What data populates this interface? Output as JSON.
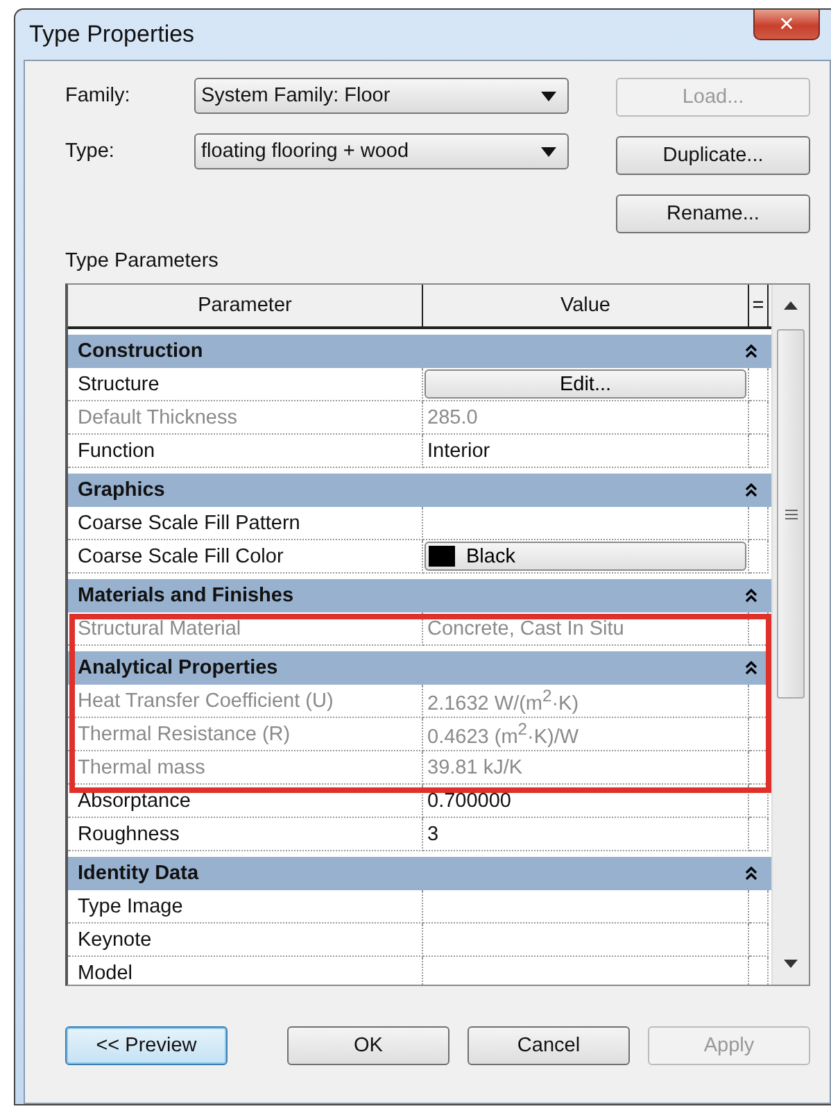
{
  "window": {
    "title": "Type Properties",
    "close": "✕"
  },
  "fields": [
    {
      "label": "Family:",
      "value": "System Family: Floor"
    },
    {
      "label": "Type:",
      "value": "floating flooring + wood"
    }
  ],
  "side_buttons": [
    {
      "label": "Load...",
      "disabled": true
    },
    {
      "label": "Duplicate...",
      "disabled": false
    },
    {
      "label": "Rename...",
      "disabled": false
    }
  ],
  "section_title": "Type Parameters",
  "table": {
    "columns": [
      "Parameter",
      "Value",
      "="
    ],
    "rows": [
      {
        "kind": "group",
        "label": "Construction",
        "expanded": true
      },
      {
        "kind": "button",
        "label": "Structure",
        "value": "Edit...",
        "disabled": false
      },
      {
        "kind": "text",
        "label": "Default Thickness",
        "value": "285.0",
        "disabled": true
      },
      {
        "kind": "text",
        "label": "Function",
        "value": "Interior",
        "disabled": false
      },
      {
        "kind": "group",
        "label": "Graphics",
        "expanded": true
      },
      {
        "kind": "text",
        "label": "Coarse Scale Fill Pattern",
        "disabled": false
      },
      {
        "kind": "color",
        "label": "Coarse Scale Fill Color",
        "value": "Black",
        "color": "#000000",
        "disabled": false
      },
      {
        "kind": "group",
        "label": "Materials and Finishes",
        "expanded": true
      },
      {
        "kind": "text",
        "label": "Structural Material",
        "value": "Concrete, Cast In Situ",
        "disabled": true
      },
      {
        "kind": "group",
        "label": "Analytical Properties",
        "expanded": true
      },
      {
        "kind": "text",
        "label": "Heat Transfer Coefficient (U)",
        "value": "2.1632 W/(m$^{2}$·K)",
        "disabled": true
      },
      {
        "kind": "text",
        "label": "Thermal Resistance (R)",
        "value": "0.4623 (m$^{2}$·K)/W",
        "disabled": true
      },
      {
        "kind": "text",
        "label": "Thermal mass",
        "value": "39.81 kJ/K",
        "disabled": true
      },
      {
        "kind": "text",
        "label": "Absorptance",
        "value": "0.700000",
        "disabled": false
      },
      {
        "kind": "text",
        "label": "Roughness",
        "value": "3",
        "disabled": false
      },
      {
        "kind": "group",
        "label": "Identity Data",
        "expanded": true
      },
      {
        "kind": "text",
        "label": "Type Image",
        "disabled": false
      },
      {
        "kind": "text",
        "label": "Keynote",
        "disabled": false
      },
      {
        "kind": "text",
        "label": "Model",
        "disabled": false
      }
    ]
  },
  "buttons": [
    {
      "label": "<< Preview",
      "focused": true,
      "disabled": false
    },
    {
      "label": "OK",
      "focused": false,
      "disabled": false
    },
    {
      "label": "Cancel",
      "focused": false,
      "disabled": false
    },
    {
      "label": "Apply",
      "focused": false,
      "disabled": true
    }
  ]
}
